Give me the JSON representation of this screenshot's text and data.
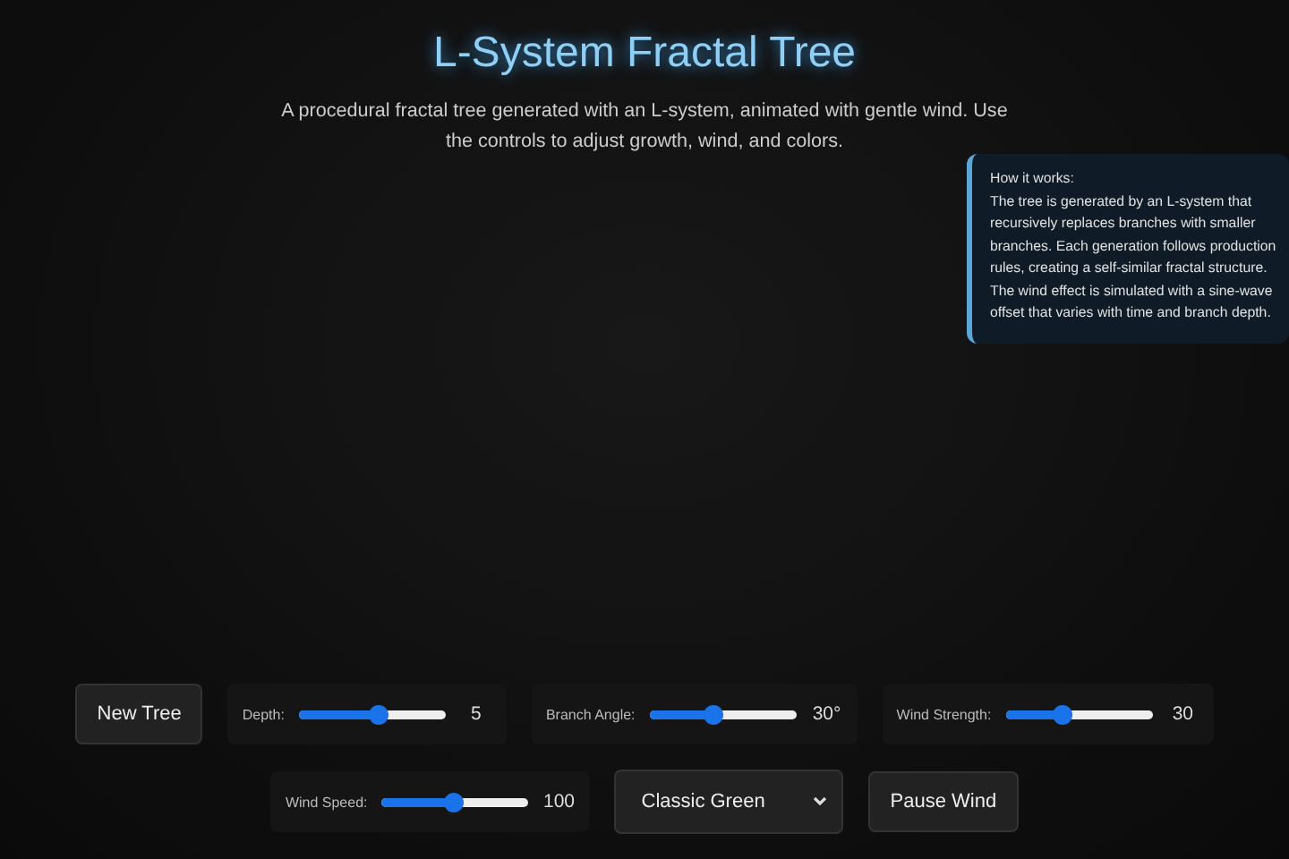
{
  "title": "L-System Fractal Tree",
  "description": "A procedural fractal tree generated with an L-system, animated with gentle wind. Use the controls to adjust growth, wind, and colors.",
  "info": {
    "heading": "How it works:",
    "body": "The tree is generated by an L-system that recursively replaces branches with smaller branches. Each generation follows production rules, creating a self-similar fractal structure. The wind effect is simulated with a sine-wave offset that varies with time and branch depth."
  },
  "controls": [
    {
      "kind": "button",
      "label": "New Tree"
    },
    {
      "kind": "slider",
      "label": "Depth:",
      "level": 0.55,
      "reading": "5"
    },
    {
      "kind": "slider",
      "label": "Branch Angle:",
      "level": 0.44,
      "reading": "30°"
    },
    {
      "kind": "slider",
      "label": "Wind Strength:",
      "level": 0.39,
      "reading": "30"
    },
    {
      "kind": "slider",
      "label": "Wind Speed:",
      "level": 0.5,
      "reading": "100"
    },
    {
      "kind": "select",
      "value": "Classic Green"
    },
    {
      "kind": "button",
      "label": "Pause Wind"
    }
  ]
}
